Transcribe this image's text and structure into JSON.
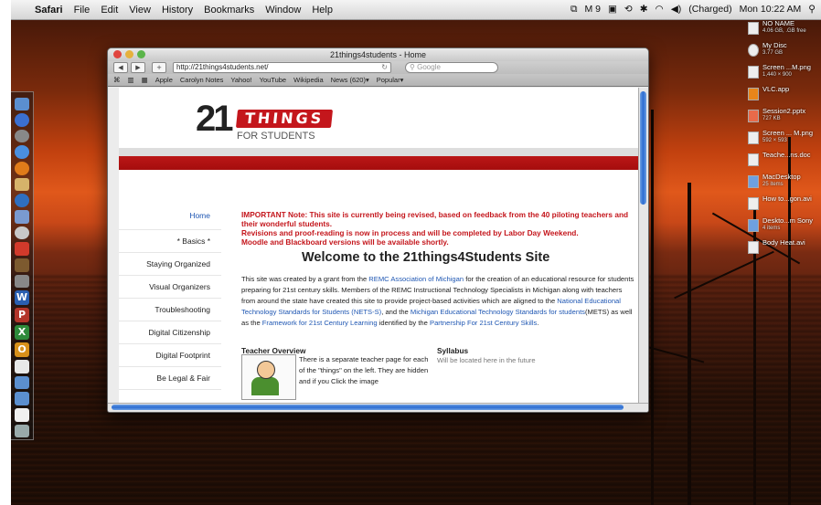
{
  "menubar": {
    "apple": "",
    "app": "Safari",
    "items": [
      "File",
      "Edit",
      "View",
      "History",
      "Bookmarks",
      "Window",
      "Help"
    ],
    "status": [
      "M 9",
      "(Charged)",
      "Mon 10:22 AM"
    ]
  },
  "desktop_icons": [
    {
      "name": "NO NAME",
      "sub": "4.06 GB, .GB free"
    },
    {
      "name": "My Disc",
      "sub": "3.77 GB"
    },
    {
      "name": "Screen ...M.png",
      "sub": "1,440 × 900"
    },
    {
      "name": "VLC.app",
      "sub": ""
    },
    {
      "name": "Session2.pptx",
      "sub": "727 KB"
    },
    {
      "name": "Screen ... M.png",
      "sub": "592 × 593"
    },
    {
      "name": "Teache...ns.doc",
      "sub": ""
    },
    {
      "name": "MacDesktop",
      "sub": "25 items"
    },
    {
      "name": "How to...gon.avi",
      "sub": ""
    },
    {
      "name": "Deskto...m Sony",
      "sub": "4 items"
    },
    {
      "name": "Body Heat.avi",
      "sub": ""
    }
  ],
  "browser": {
    "title": "21things4students - Home",
    "url": "http://21things4students.net/",
    "search_placeholder": "Google",
    "bookmarks": [
      "Apple",
      "Carolyn Notes",
      "Yahoo!",
      "YouTube",
      "Wikipedia",
      "News (620)▾",
      "Popular▾"
    ]
  },
  "page": {
    "logo_number": "21",
    "logo_things": "THINGS",
    "logo_sub": "FOR STUDENTS",
    "nav": [
      "Home",
      "* Basics *",
      "Staying Organized",
      "Visual Organizers",
      "Troubleshooting",
      "Digital Citizenship",
      "Digital Footprint",
      "Be Legal & Fair"
    ],
    "important": "IMPORTANT Note: This site is currently being revised, based on feedback from the 40 piloting teachers and their wonderful students.\nRevisions and proof-reading is now in process and will be completed by Labor Day Weekend.\nMoodle and Blackboard versions will be available shortly.",
    "welcome": "Welcome to the 21things4Students Site",
    "intro": {
      "p1": "This site was created by a grant from the ",
      "l1": "REMC Association of Michigan",
      "p2": " for the creation of an educational resource for students preparing for 21st century skills. Members of the REMC Instructional Technology Specialists in Michigan along with teachers from around the state have created this site to provide project-based activities which are aligned to the ",
      "l2": "National Educational Technology Standards for Students (NETS-S)",
      "p3": ", and the ",
      "l3": "Michigan Educational Technology Standards for students",
      "p4": "(METS) as well as the ",
      "l4": "Framework for 21st Century Learning",
      "p5": " identified by the ",
      "l5": "Partnership For 21st Century Skills",
      "p6": "."
    },
    "teacher_heading": "Teacher Overview",
    "teacher_text": "There is a separate teacher page for each of the \"things\" on the left. They are hidden and if you Click the image",
    "syllabus_heading": "Syllabus",
    "syllabus_text": "Will be located here in the future"
  }
}
